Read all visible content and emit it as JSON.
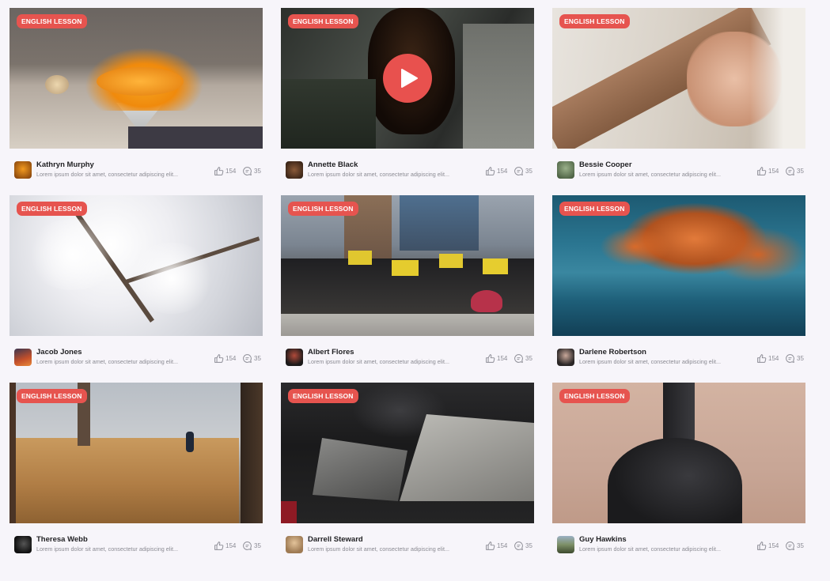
{
  "cards": [
    {
      "badge": "ENGLISH LESSON",
      "author": "Kathryn Murphy",
      "description": "Lorem ipsum dolor sit amet, consectetur adipiscing elit...",
      "likes": "154",
      "comments": "35",
      "has_play": false
    },
    {
      "badge": "ENGLISH LESSON",
      "author": "Annette Black",
      "description": "Lorem ipsum dolor sit amet, consectetur adipiscing elit...",
      "likes": "154",
      "comments": "35",
      "has_play": true
    },
    {
      "badge": "ENGLISH LESSON",
      "author": "Bessie Cooper",
      "description": "Lorem ipsum dolor sit amet, consectetur adipiscing elit...",
      "likes": "154",
      "comments": "35",
      "has_play": false
    },
    {
      "badge": "ENGLISH LESSON",
      "author": "Jacob Jones",
      "description": "Lorem ipsum dolor sit amet, consectetur adipiscing elit...",
      "likes": "154",
      "comments": "35",
      "has_play": false
    },
    {
      "badge": "ENGLISH LESSON",
      "author": "Albert Flores",
      "description": "Lorem ipsum dolor sit amet, consectetur adipiscing elit...",
      "likes": "154",
      "comments": "35",
      "has_play": false
    },
    {
      "badge": "ENGLISH LESSON",
      "author": "Darlene Robertson",
      "description": "Lorem ipsum dolor sit amet, consectetur adipiscing elit...",
      "likes": "154",
      "comments": "35",
      "has_play": false
    },
    {
      "badge": "ENGLISH LESSON",
      "author": "Theresa Webb",
      "description": "Lorem ipsum dolor sit amet, consectetur adipiscing elit...",
      "likes": "154",
      "comments": "35",
      "has_play": false
    },
    {
      "badge": "ENGLISH LESSON",
      "author": "Darrell Steward",
      "description": "Lorem ipsum dolor sit amet, consectetur adipiscing elit...",
      "likes": "154",
      "comments": "35",
      "has_play": false
    },
    {
      "badge": "ENGLISH LESSON",
      "author": "Guy Hawkins",
      "description": "Lorem ipsum dolor sit amet, consectetur adipiscing elit...",
      "likes": "154",
      "comments": "35",
      "has_play": false
    }
  ],
  "colors": {
    "badge": "#e6544f",
    "play_button": "#e8514e",
    "page_background": "#f7f5fa"
  },
  "icons": {
    "like": "thumbs-up-icon",
    "comment": "comment-bubble-icon",
    "play": "play-icon"
  }
}
